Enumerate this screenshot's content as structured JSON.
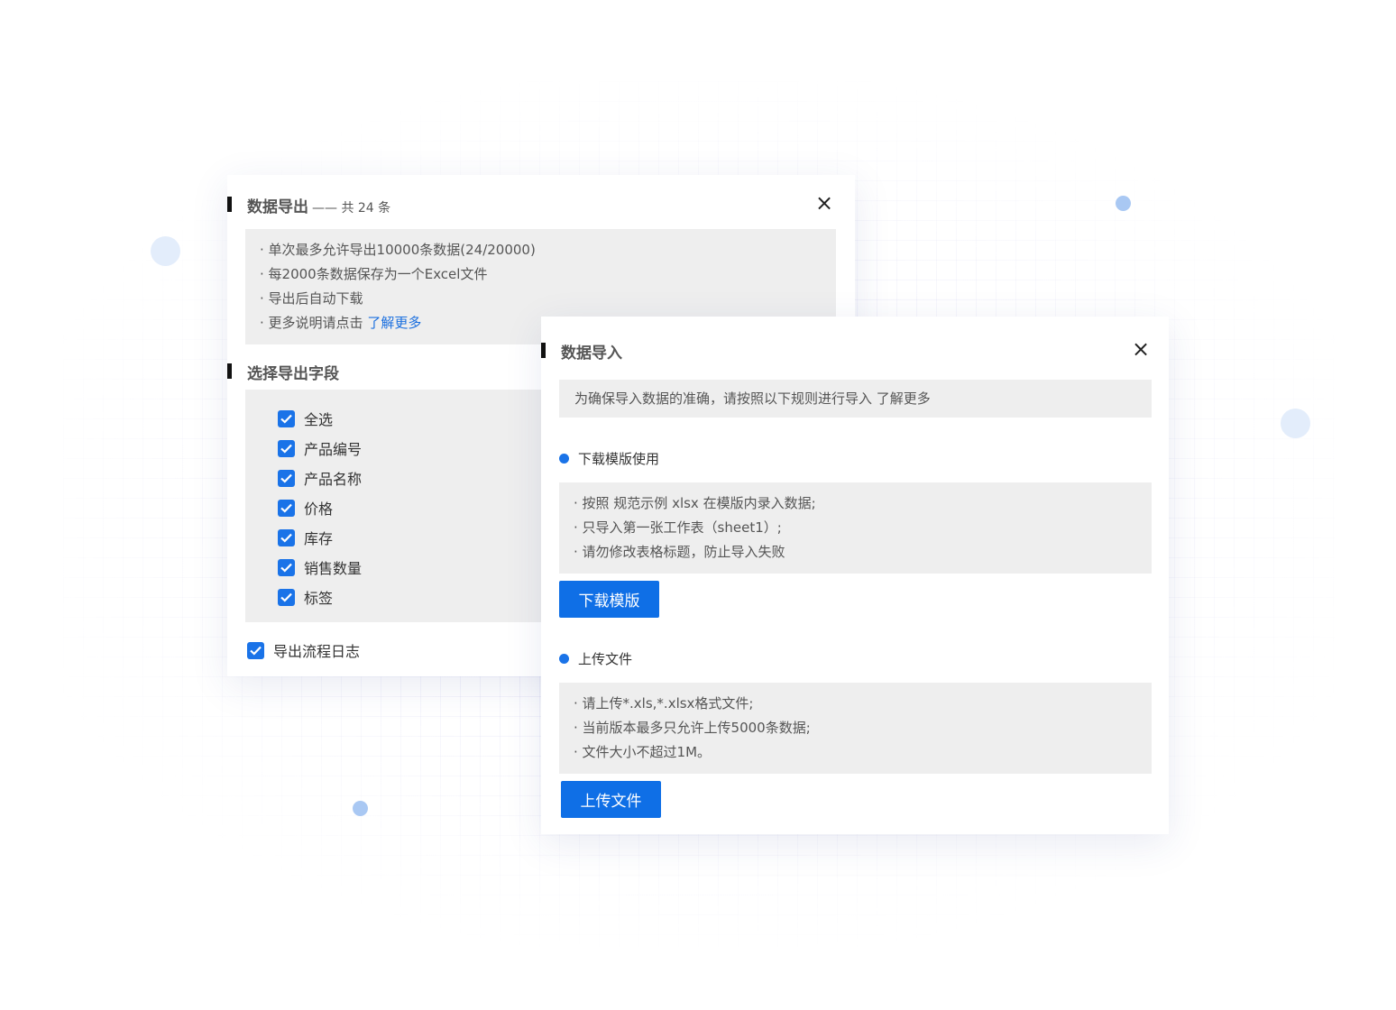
{
  "export_dialog": {
    "title": "数据导出",
    "count_suffix": "—— 共 24 条",
    "notes": [
      "· 单次最多允许导出10000条数据(24/20000)",
      "· 每2000条数据保存为一个Excel文件",
      "· 导出后自动下载"
    ],
    "more_prefix": "· 更多说明请点击 ",
    "more_link": "了解更多",
    "fields_title": "选择导出字段",
    "fields": [
      "全选",
      "产品编号",
      "产品名称",
      "价格",
      "库存",
      "销售数量",
      "标签"
    ],
    "log_option": "导出流程日志",
    "close_icon": "×"
  },
  "import_dialog": {
    "title": "数据导入",
    "intro": "为确保导入数据的准确，请按照以下规则进行导入 了解更多",
    "download_section": {
      "title": "下载模版使用",
      "notes": [
        "· 按照 规范示例 xlsx 在模版内录入数据;",
        "· 只导入第一张工作表（sheet1）;",
        "· 请勿修改表格标题，防止导入失败"
      ],
      "button": "下载模版"
    },
    "upload_section": {
      "title": "上传文件",
      "notes": [
        "· 请上传*.xls,*.xlsx格式文件;",
        "· 当前版本最多只允许上传5000条数据;",
        "· 文件大小不超过1M。"
      ],
      "button": "上传文件"
    },
    "close_icon": "×"
  },
  "colors": {
    "accent": "#1a73e8",
    "button": "#0f6fe6",
    "info_bg": "#eeeeee",
    "link": "#1a6fdf"
  }
}
